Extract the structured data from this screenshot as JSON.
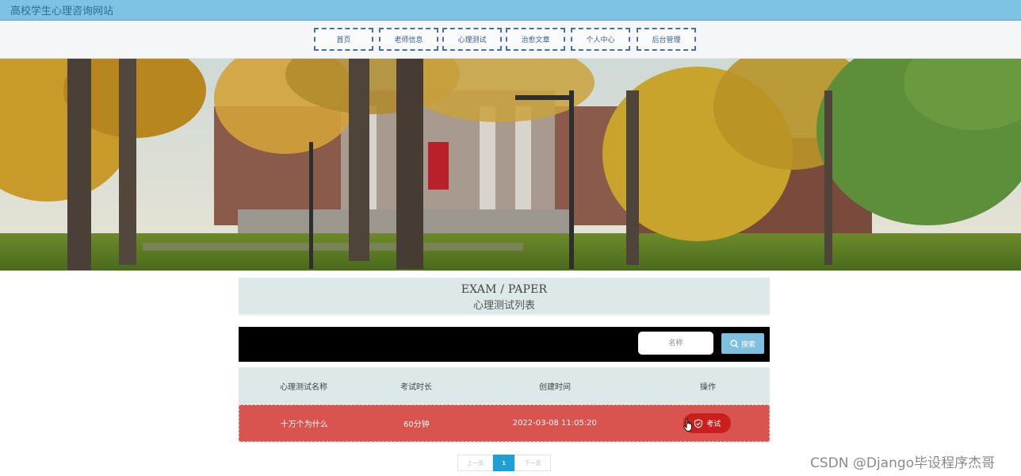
{
  "site": {
    "title": "高校学生心理咨询网站"
  },
  "nav": {
    "items": [
      {
        "label": "首页"
      },
      {
        "label": "老师信息"
      },
      {
        "label": "心理测试"
      },
      {
        "label": "治愈文章"
      },
      {
        "label": "个人中心"
      },
      {
        "label": "后台管理"
      }
    ]
  },
  "banner": {
    "slides": 3,
    "active": 1
  },
  "section": {
    "title_en": "EXAM / PAPER",
    "title_zh": "心理测试列表"
  },
  "search": {
    "placeholder": "名称",
    "button_label": "搜索"
  },
  "table": {
    "headers": [
      "心理测试名称",
      "考试时长",
      "创建时间",
      "操作"
    ],
    "rows": [
      {
        "name": "十万个为什么",
        "duration": "60分钟",
        "created": "2022-03-08 11:05:20",
        "action_label": "考试"
      }
    ]
  },
  "pagination": {
    "prev_label": "上一页",
    "current": "1",
    "next_label": "下一页"
  },
  "watermark": "CSDN @Django毕设程序杰哥",
  "colors": {
    "topbar": "#7ec3e4",
    "nav_border": "#4a6fa5",
    "row_highlight": "#d9534f",
    "exam_button": "#c9201f",
    "search_button": "#7fbfe0",
    "pager_active": "#1e9fd6"
  }
}
